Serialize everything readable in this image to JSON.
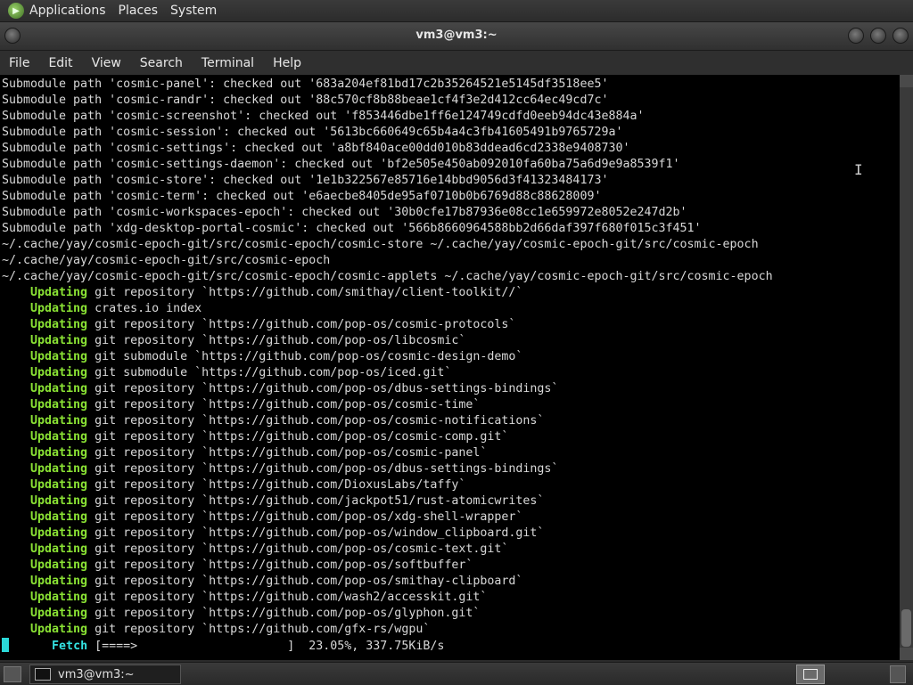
{
  "top_panel": {
    "menus": [
      "Applications",
      "Places",
      "System"
    ]
  },
  "window": {
    "title": "vm3@vm3:~"
  },
  "menu_bar": {
    "items": [
      "File",
      "Edit",
      "View",
      "Search",
      "Terminal",
      "Help"
    ]
  },
  "terminal": {
    "lines": [
      {
        "k": "",
        "t": "Submodule path 'cosmic-panel': checked out '683a204ef81bd17c2b35264521e5145df3518ee5'"
      },
      {
        "k": "",
        "t": "Submodule path 'cosmic-randr': checked out '88c570cf8b88beae1cf4f3e2d412cc64ec49cd7c'"
      },
      {
        "k": "",
        "t": "Submodule path 'cosmic-screenshot': checked out 'f853446dbe1ff6e124749cdfd0eeb94dc43e884a'"
      },
      {
        "k": "",
        "t": "Submodule path 'cosmic-session': checked out '5613bc660649c65b4a4c3fb41605491b9765729a'"
      },
      {
        "k": "",
        "t": "Submodule path 'cosmic-settings': checked out 'a8bf840ace00dd010b83ddead6cd2338e9408730'"
      },
      {
        "k": "",
        "t": "Submodule path 'cosmic-settings-daemon': checked out 'bf2e505e450ab092010fa60ba75a6d9e9a8539f1'"
      },
      {
        "k": "",
        "t": "Submodule path 'cosmic-store': checked out '1e1b322567e85716e14bbd9056d3f41323484173'"
      },
      {
        "k": "",
        "t": "Submodule path 'cosmic-term': checked out 'e6aecbe8405de95af0710b0b6769d88c88628009'"
      },
      {
        "k": "",
        "t": "Submodule path 'cosmic-workspaces-epoch': checked out '30b0cfe17b87936e08cc1e659972e8052e247d2b'"
      },
      {
        "k": "",
        "t": "Submodule path 'xdg-desktop-portal-cosmic': checked out '566b8660964588bb2d66daf397f680f015c3f451'"
      },
      {
        "k": "",
        "t": "~/.cache/yay/cosmic-epoch-git/src/cosmic-epoch/cosmic-store ~/.cache/yay/cosmic-epoch-git/src/cosmic-epoch"
      },
      {
        "k": "",
        "t": "~/.cache/yay/cosmic-epoch-git/src/cosmic-epoch"
      },
      {
        "k": "",
        "t": "~/.cache/yay/cosmic-epoch-git/src/cosmic-epoch/cosmic-applets ~/.cache/yay/cosmic-epoch-git/src/cosmic-epoch"
      },
      {
        "k": "    Updating",
        "t": " git repository `https://github.com/smithay/client-toolkit//`"
      },
      {
        "k": "    Updating",
        "t": " crates.io index"
      },
      {
        "k": "    Updating",
        "t": " git repository `https://github.com/pop-os/cosmic-protocols`"
      },
      {
        "k": "    Updating",
        "t": " git repository `https://github.com/pop-os/libcosmic`"
      },
      {
        "k": "    Updating",
        "t": " git submodule `https://github.com/pop-os/cosmic-design-demo`"
      },
      {
        "k": "    Updating",
        "t": " git submodule `https://github.com/pop-os/iced.git`"
      },
      {
        "k": "    Updating",
        "t": " git repository `https://github.com/pop-os/dbus-settings-bindings`"
      },
      {
        "k": "    Updating",
        "t": " git repository `https://github.com/pop-os/cosmic-time`"
      },
      {
        "k": "    Updating",
        "t": " git repository `https://github.com/pop-os/cosmic-notifications`"
      },
      {
        "k": "    Updating",
        "t": " git repository `https://github.com/pop-os/cosmic-comp.git`"
      },
      {
        "k": "    Updating",
        "t": " git repository `https://github.com/pop-os/cosmic-panel`"
      },
      {
        "k": "    Updating",
        "t": " git repository `https://github.com/pop-os/dbus-settings-bindings`"
      },
      {
        "k": "    Updating",
        "t": " git repository `https://github.com/DioxusLabs/taffy`"
      },
      {
        "k": "    Updating",
        "t": " git repository `https://github.com/jackpot51/rust-atomicwrites`"
      },
      {
        "k": "    Updating",
        "t": " git repository `https://github.com/pop-os/xdg-shell-wrapper`"
      },
      {
        "k": "    Updating",
        "t": " git repository `https://github.com/pop-os/window_clipboard.git`"
      },
      {
        "k": "    Updating",
        "t": " git repository `https://github.com/pop-os/cosmic-text.git`"
      },
      {
        "k": "    Updating",
        "t": " git repository `https://github.com/pop-os/softbuffer`"
      },
      {
        "k": "    Updating",
        "t": " git repository `https://github.com/pop-os/smithay-clipboard`"
      },
      {
        "k": "    Updating",
        "t": " git repository `https://github.com/wash2/accesskit.git`"
      },
      {
        "k": "    Updating",
        "t": " git repository `https://github.com/pop-os/glyphon.git`"
      },
      {
        "k": "    Updating",
        "t": " git repository `https://github.com/gfx-rs/wgpu`"
      }
    ],
    "fetch_label": "Fetch",
    "fetch_bar": " [====>                     ]  23.05%, 337.75KiB/s",
    "colors": {
      "keyword": "#8ae234",
      "fetch": "#34e2e2",
      "text": "#d8d8d8"
    }
  },
  "taskbar": {
    "window_button": "vm3@vm3:~"
  }
}
